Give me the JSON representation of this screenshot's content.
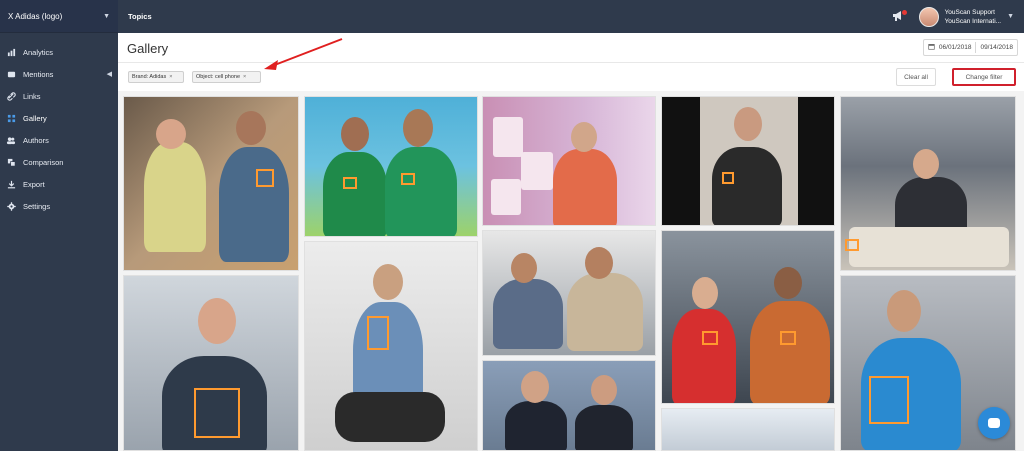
{
  "sidebar": {
    "brand": "X Adidas (logo)",
    "items": [
      {
        "label": "Analytics",
        "icon": "bar-chart-icon"
      },
      {
        "label": "Mentions",
        "icon": "list-icon"
      },
      {
        "label": "Links",
        "icon": "link-icon"
      },
      {
        "label": "Gallery",
        "icon": "grid-icon"
      },
      {
        "label": "Authors",
        "icon": "users-icon"
      },
      {
        "label": "Comparison",
        "icon": "compare-icon"
      },
      {
        "label": "Export",
        "icon": "download-icon"
      },
      {
        "label": "Settings",
        "icon": "gear-icon"
      }
    ],
    "active_item": "Gallery"
  },
  "topbar": {
    "title": "Topics",
    "user_name": "YouScan Support",
    "user_org": "YouScan Internati..."
  },
  "header": {
    "page_title": "Gallery",
    "date_from": "06/01/2018",
    "date_to": "09/14/2018"
  },
  "filters": {
    "chips": [
      {
        "label": "Brand: Adidas"
      },
      {
        "label": "Object: cell phone"
      }
    ],
    "clear_label": "Clear all",
    "change_label": "Change filter"
  },
  "colors": {
    "sidebar_bg": "#2f3a4c",
    "highlight_red": "#d0202c",
    "detection_orange": "#ff9a2f",
    "chat_blue": "#2b8ad8"
  }
}
